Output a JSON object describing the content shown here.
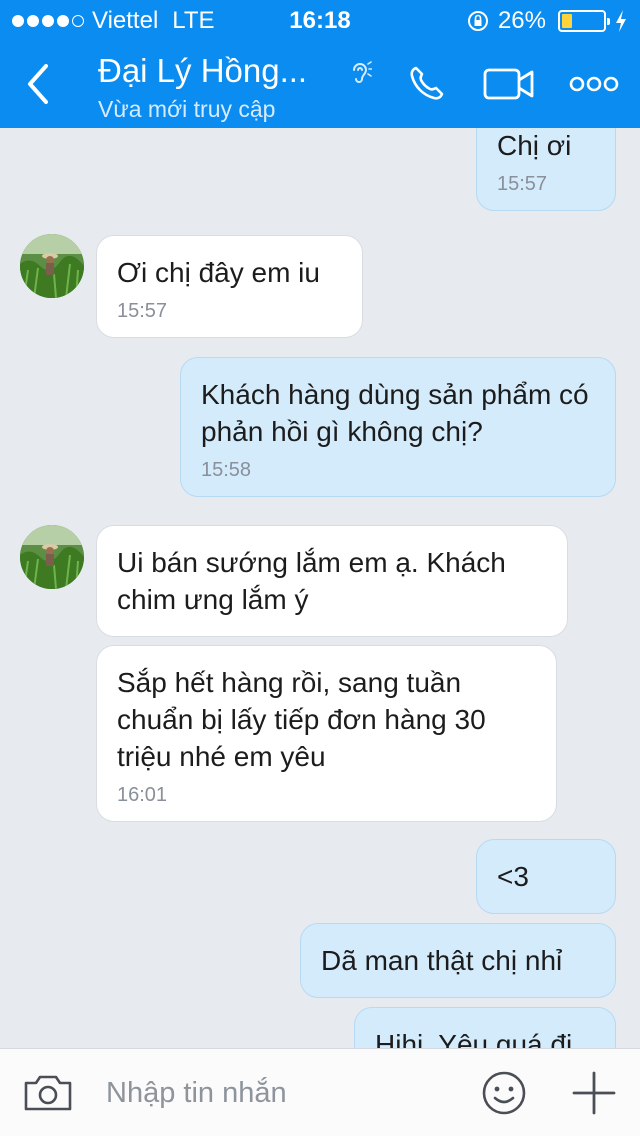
{
  "status_bar": {
    "carrier": "Viettel",
    "network": "LTE",
    "time": "16:18",
    "battery_percent": "26%",
    "battery_level": 0.26,
    "signal_bars_filled": 4,
    "signal_bars_total": 5
  },
  "header": {
    "title": "Đại Lý Hồng...",
    "subtitle": "Vừa mới truy cập",
    "icons": [
      "back-chevron-icon",
      "hearing-icon",
      "phone-icon",
      "video-call-icon",
      "more-options-icon"
    ]
  },
  "messages": [
    {
      "direction": "out",
      "text": "Chị ơi",
      "time": "15:57"
    },
    {
      "direction": "in",
      "text": "Ơi chị đây em iu",
      "time": "15:57"
    },
    {
      "direction": "out",
      "text": "Khách hàng dùng sản phẩm có phản hồi gì không chị?",
      "time": "15:58"
    },
    {
      "direction": "in",
      "text": "Ui bán sướng lắm em ạ. Khách chim ưng lắm ý",
      "time": ""
    },
    {
      "direction": "in",
      "text": "Sắp hết hàng rồi, sang tuần chuẩn bị lấy tiếp đơn hàng 30 triệu nhé em yêu",
      "time": "16:01"
    },
    {
      "direction": "out",
      "text": "<3",
      "time": ""
    },
    {
      "direction": "out",
      "text": "Dã man thật chị nhỉ",
      "time": ""
    },
    {
      "direction": "out",
      "text": "Hihi. Yêu quá đi",
      "time": ""
    }
  ],
  "input": {
    "placeholder": "Nhập tin nhắn",
    "icons": [
      "camera-icon",
      "emoji-icon",
      "plus-icon"
    ]
  },
  "colors": {
    "header_bg": "#0a8cf0",
    "chat_bg": "#e7ebf0",
    "outgoing_bubble": "#d4ebfc",
    "incoming_bubble": "#ffffff",
    "battery_fill": "#ffd33a"
  }
}
